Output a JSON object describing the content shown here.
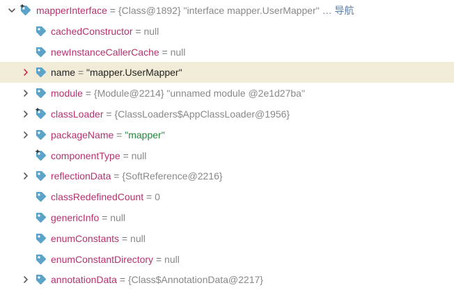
{
  "rows": [
    {
      "name": "mapperInterface",
      "eq": " = ",
      "value": "{Class@1892} \"interface mapper.UserMapper\"",
      "value_type": "gray",
      "suffix": "… 导航",
      "arrow": "expanded",
      "icon": "field-static-icon"
    },
    {
      "name": "cachedConstructor",
      "eq": " = ",
      "value": "null",
      "value_type": "gray",
      "suffix": "",
      "arrow": "none",
      "icon": "field-tag-icon"
    },
    {
      "name": "newInstanceCallerCache",
      "eq": " = ",
      "value": "null",
      "value_type": "gray",
      "suffix": "",
      "arrow": "none",
      "icon": "field-tag-icon"
    },
    {
      "name": "name",
      "eq": " = ",
      "value": "\"mapper.UserMapper\"",
      "value_type": "str",
      "suffix": "",
      "arrow": "collapsed",
      "icon": "field-tag-icon",
      "selected": true
    },
    {
      "name": "module",
      "eq": " = ",
      "value": "{Module@2214} \"unnamed module @2e1d27ba\"",
      "value_type": "gray",
      "suffix": "",
      "arrow": "collapsed",
      "icon": "field-tag-icon"
    },
    {
      "name": "classLoader",
      "eq": " = ",
      "value": "{ClassLoaders$AppClassLoader@1956}",
      "value_type": "gray",
      "suffix": "",
      "arrow": "collapsed",
      "icon": "field-static-icon"
    },
    {
      "name": "packageName",
      "eq": " = ",
      "value": "\"mapper\"",
      "value_type": "str",
      "suffix": "",
      "arrow": "collapsed",
      "icon": "field-tag-icon"
    },
    {
      "name": "componentType",
      "eq": " = ",
      "value": "null",
      "value_type": "gray",
      "suffix": "",
      "arrow": "none",
      "icon": "field-static-icon"
    },
    {
      "name": "reflectionData",
      "eq": " = ",
      "value": "{SoftReference@2216}",
      "value_type": "gray",
      "suffix": "",
      "arrow": "collapsed",
      "icon": "field-tag-icon"
    },
    {
      "name": "classRedefinedCount",
      "eq": " = ",
      "value": "0",
      "value_type": "num",
      "suffix": "",
      "arrow": "none",
      "icon": "field-tag-icon"
    },
    {
      "name": "genericInfo",
      "eq": " = ",
      "value": "null",
      "value_type": "gray",
      "suffix": "",
      "arrow": "none",
      "icon": "field-tag-icon"
    },
    {
      "name": "enumConstants",
      "eq": " = ",
      "value": "null",
      "value_type": "gray",
      "suffix": "",
      "arrow": "none",
      "icon": "field-tag-icon"
    },
    {
      "name": "enumConstantDirectory",
      "eq": " = ",
      "value": "null",
      "value_type": "gray",
      "suffix": "",
      "arrow": "none",
      "icon": "field-tag-icon"
    },
    {
      "name": "annotationData",
      "eq": " = ",
      "value": "{Class$AnnotationData@2217}",
      "value_type": "gray",
      "suffix": "",
      "arrow": "collapsed",
      "icon": "field-tag-icon"
    }
  ],
  "colors": {
    "field_name": "#b5316f",
    "tag_icon": "#5ba3c8",
    "selected_bg": "#f1ecd8",
    "selected_arrow": "#c8334d",
    "string_value": "#22863a",
    "gray_value": "#888888"
  }
}
